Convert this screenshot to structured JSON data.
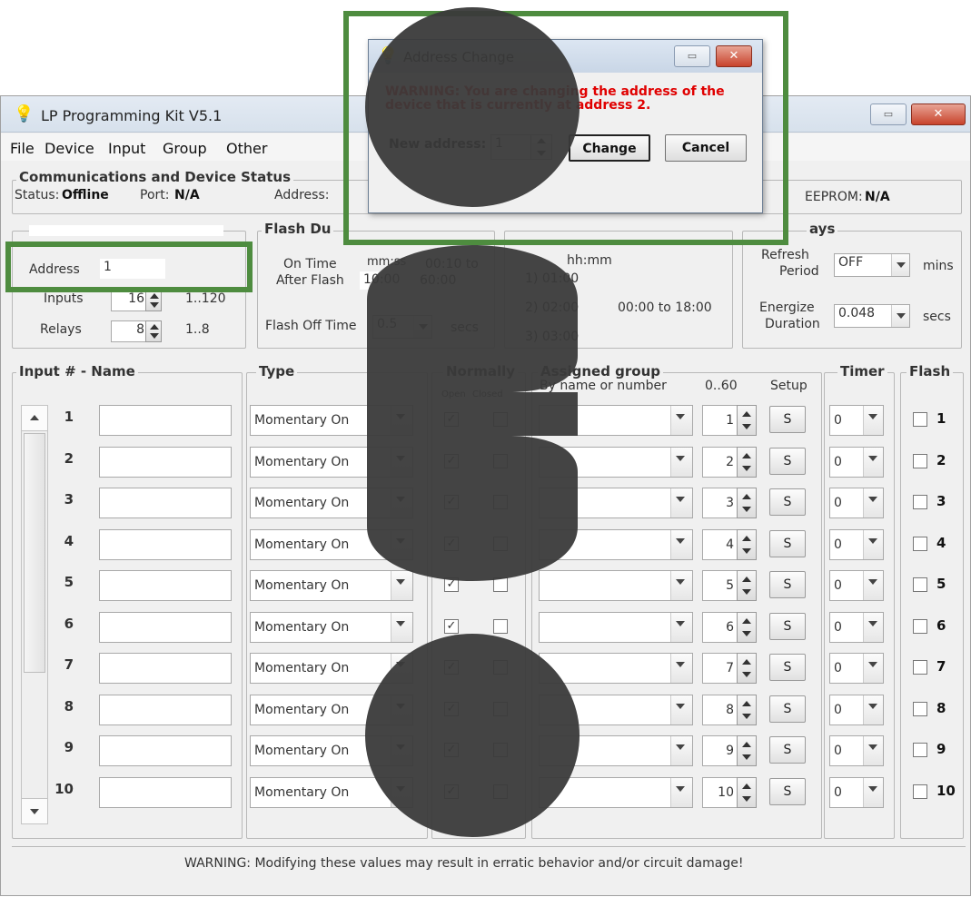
{
  "main": {
    "title": "LP Programming Kit V5.1",
    "menu": [
      "File",
      "Device",
      "Input",
      "Group",
      "Other"
    ],
    "comm": {
      "group_title": "Communications and Device Status",
      "status_label": "Status:",
      "status_value": "Offline",
      "port_label": "Port:",
      "port_value": "N/A",
      "address_label": "Address:",
      "eeprom_label": "EEPROM:",
      "eeprom_value": "N/A"
    },
    "device": {
      "address_label": "Address",
      "address_value": "1",
      "inputs_label": "Inputs",
      "inputs_value": "16",
      "inputs_range": "1..120",
      "relays_label": "Relays",
      "relays_value": "8",
      "relays_range": "1..8"
    },
    "flash": {
      "group_title": "Flash Du",
      "on_time_label": "On Time",
      "on_time_unit": "mm:ss",
      "on_time_range": "00:10 to",
      "after_flash_label": "After Flash",
      "after_flash_value": "10:00",
      "after_flash_range": "60:00",
      "off_time_label": "Flash Off Time",
      "off_time_value": "0.5",
      "off_time_unit": "secs"
    },
    "schedule": {
      "header": "hh:mm",
      "items": [
        "1)  01:00",
        "2)  02:00",
        "3)  03:00"
      ],
      "range": "00:00 to 18:00"
    },
    "relays": {
      "group_title": "ays",
      "refresh_label_1": "Refresh",
      "refresh_label_2": "Period",
      "refresh_value": "OFF",
      "refresh_unit": "mins",
      "energize_label_1": "Energize",
      "energize_label_2": "Duration",
      "energize_value": "0.048",
      "energize_unit": "secs"
    },
    "table": {
      "col_input": "Input # - Name",
      "col_type": "Type",
      "col_normally": "Normally",
      "col_open": "Open",
      "col_closed": "Closed",
      "col_group": "Assigned group",
      "col_group_sub": "By name or number",
      "col_range": "0..60",
      "col_setup": "Setup",
      "col_timer": "Timer",
      "col_flash": "Flash",
      "setup_label": "S",
      "rows": [
        {
          "num": "1",
          "type": "Momentary On",
          "group": "1",
          "timer": "0",
          "flash": "1"
        },
        {
          "num": "2",
          "type": "Momentary On",
          "group": "2",
          "timer": "0",
          "flash": "2"
        },
        {
          "num": "3",
          "type": "Momentary On",
          "group": "3",
          "timer": "0",
          "flash": "3"
        },
        {
          "num": "4",
          "type": "Momentary On",
          "group": "4",
          "timer": "0",
          "flash": "4"
        },
        {
          "num": "5",
          "type": "Momentary On",
          "group": "5",
          "timer": "0",
          "flash": "5"
        },
        {
          "num": "6",
          "type": "Momentary On",
          "group": "6",
          "timer": "0",
          "flash": "6"
        },
        {
          "num": "7",
          "type": "Momentary On",
          "group": "7",
          "timer": "0",
          "flash": "7"
        },
        {
          "num": "8",
          "type": "Momentary On",
          "group": "8",
          "timer": "0",
          "flash": "8"
        },
        {
          "num": "9",
          "type": "Momentary On",
          "group": "9",
          "timer": "0",
          "flash": "9"
        },
        {
          "num": "10",
          "type": "Momentary On",
          "group": "10",
          "timer": "0",
          "flash": "10"
        }
      ]
    },
    "footer_warning": "WARNING: Modifying these values may result in erratic behavior and/or circuit damage!"
  },
  "dialog": {
    "title": "Address Change",
    "warning": "WARNING: You are changing the address of the device that is currently at address 2.",
    "new_address_label": "New address:",
    "new_address_value": "1",
    "change_label": "Change",
    "cancel_label": "Cancel"
  },
  "watermark": {
    "text": "oso",
    "color": "#3a3a3a"
  },
  "colors": {
    "highlight": "#4e8c3f",
    "warning_red": "#e00000"
  }
}
